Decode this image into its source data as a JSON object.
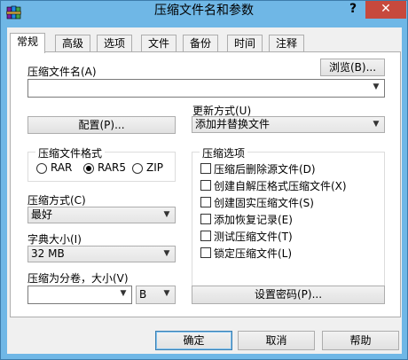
{
  "window": {
    "title": "压缩文件名和参数",
    "help_glyph": "?",
    "close_glyph": "✕",
    "icon": "winrar-books-icon"
  },
  "tabs": [
    {
      "label": "常规",
      "active": true
    },
    {
      "label": "高级",
      "active": false
    },
    {
      "label": "选项",
      "active": false
    },
    {
      "label": "文件",
      "active": false
    },
    {
      "label": "备份",
      "active": false
    },
    {
      "label": "时间",
      "active": false
    },
    {
      "label": "注释",
      "active": false
    }
  ],
  "archive_name": {
    "label": "压缩文件名(A)",
    "value": "",
    "browse_label": "浏览(B)..."
  },
  "update_mode": {
    "label": "更新方式(U)",
    "value": "添加并替换文件"
  },
  "profiles_button": "配置(P)...",
  "archive_format": {
    "title": "压缩文件格式",
    "options": [
      {
        "label": "RAR",
        "selected": false
      },
      {
        "label": "RAR5",
        "selected": true
      },
      {
        "label": "ZIP",
        "selected": false
      }
    ]
  },
  "compression_method": {
    "label": "压缩方式(C)",
    "value": "最好"
  },
  "dictionary_size": {
    "label": "字典大小(I)",
    "value": "32 MB"
  },
  "split_volumes": {
    "label": "压缩为分卷，大小(V)",
    "size_value": "",
    "unit_value": "B"
  },
  "archiving_options": {
    "title": "压缩选项",
    "items": [
      {
        "label": "压缩后删除源文件(D)",
        "checked": false
      },
      {
        "label": "创建自解压格式压缩文件(X)",
        "checked": false
      },
      {
        "label": "创建固实压缩文件(S)",
        "checked": false
      },
      {
        "label": "添加恢复记录(E)",
        "checked": false
      },
      {
        "label": "测试压缩文件(T)",
        "checked": false
      },
      {
        "label": "锁定压缩文件(L)",
        "checked": false
      }
    ]
  },
  "set_password_button": "设置密码(P)...",
  "footer": {
    "ok": "确定",
    "cancel": "取消",
    "help": "帮助"
  }
}
